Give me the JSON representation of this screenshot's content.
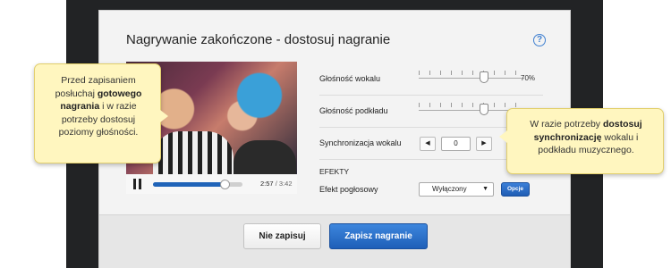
{
  "dialog": {
    "title": "Nagrywanie zakończone - dostosuj nagranie",
    "help_icon": "?"
  },
  "player": {
    "time_current": "2:57",
    "time_separator": "/",
    "time_total": "3:42",
    "progress_fraction": 0.8
  },
  "controls": {
    "vocal_volume_label": "Głośność wokalu",
    "vocal_volume_value": "70%",
    "vocal_volume_level": 0.62,
    "backing_volume_label": "Głośność podkładu",
    "backing_volume_level": 0.62,
    "sync_label": "Synchronizacja wokalu",
    "sync_value": "0",
    "sync_prev_icon": "◀",
    "sync_next_icon": "▶",
    "effects_heading": "EFEKTY",
    "reverb_label": "Efekt pogłosowy",
    "reverb_selected": "Wyłączony",
    "reverb_options_button": "Opcje"
  },
  "footer": {
    "cancel_label": "Nie zapisuj",
    "save_label": "Zapisz nagranie"
  },
  "callouts": {
    "left": {
      "text_1": "Przed zapisaniem posłuchaj ",
      "bold_1": "gotowego nagrania",
      "text_2": " i w razie potrzeby dostosuj poziomy głośności."
    },
    "right": {
      "text_1": "W razie potrzeby ",
      "bold_1": "dostosuj synchronizację",
      "text_2": " wokalu i podkładu muzycznego."
    }
  },
  "colors": {
    "accent": "#1f63b8",
    "callout_bg": "#fff6bf",
    "backdrop": "#222325"
  }
}
